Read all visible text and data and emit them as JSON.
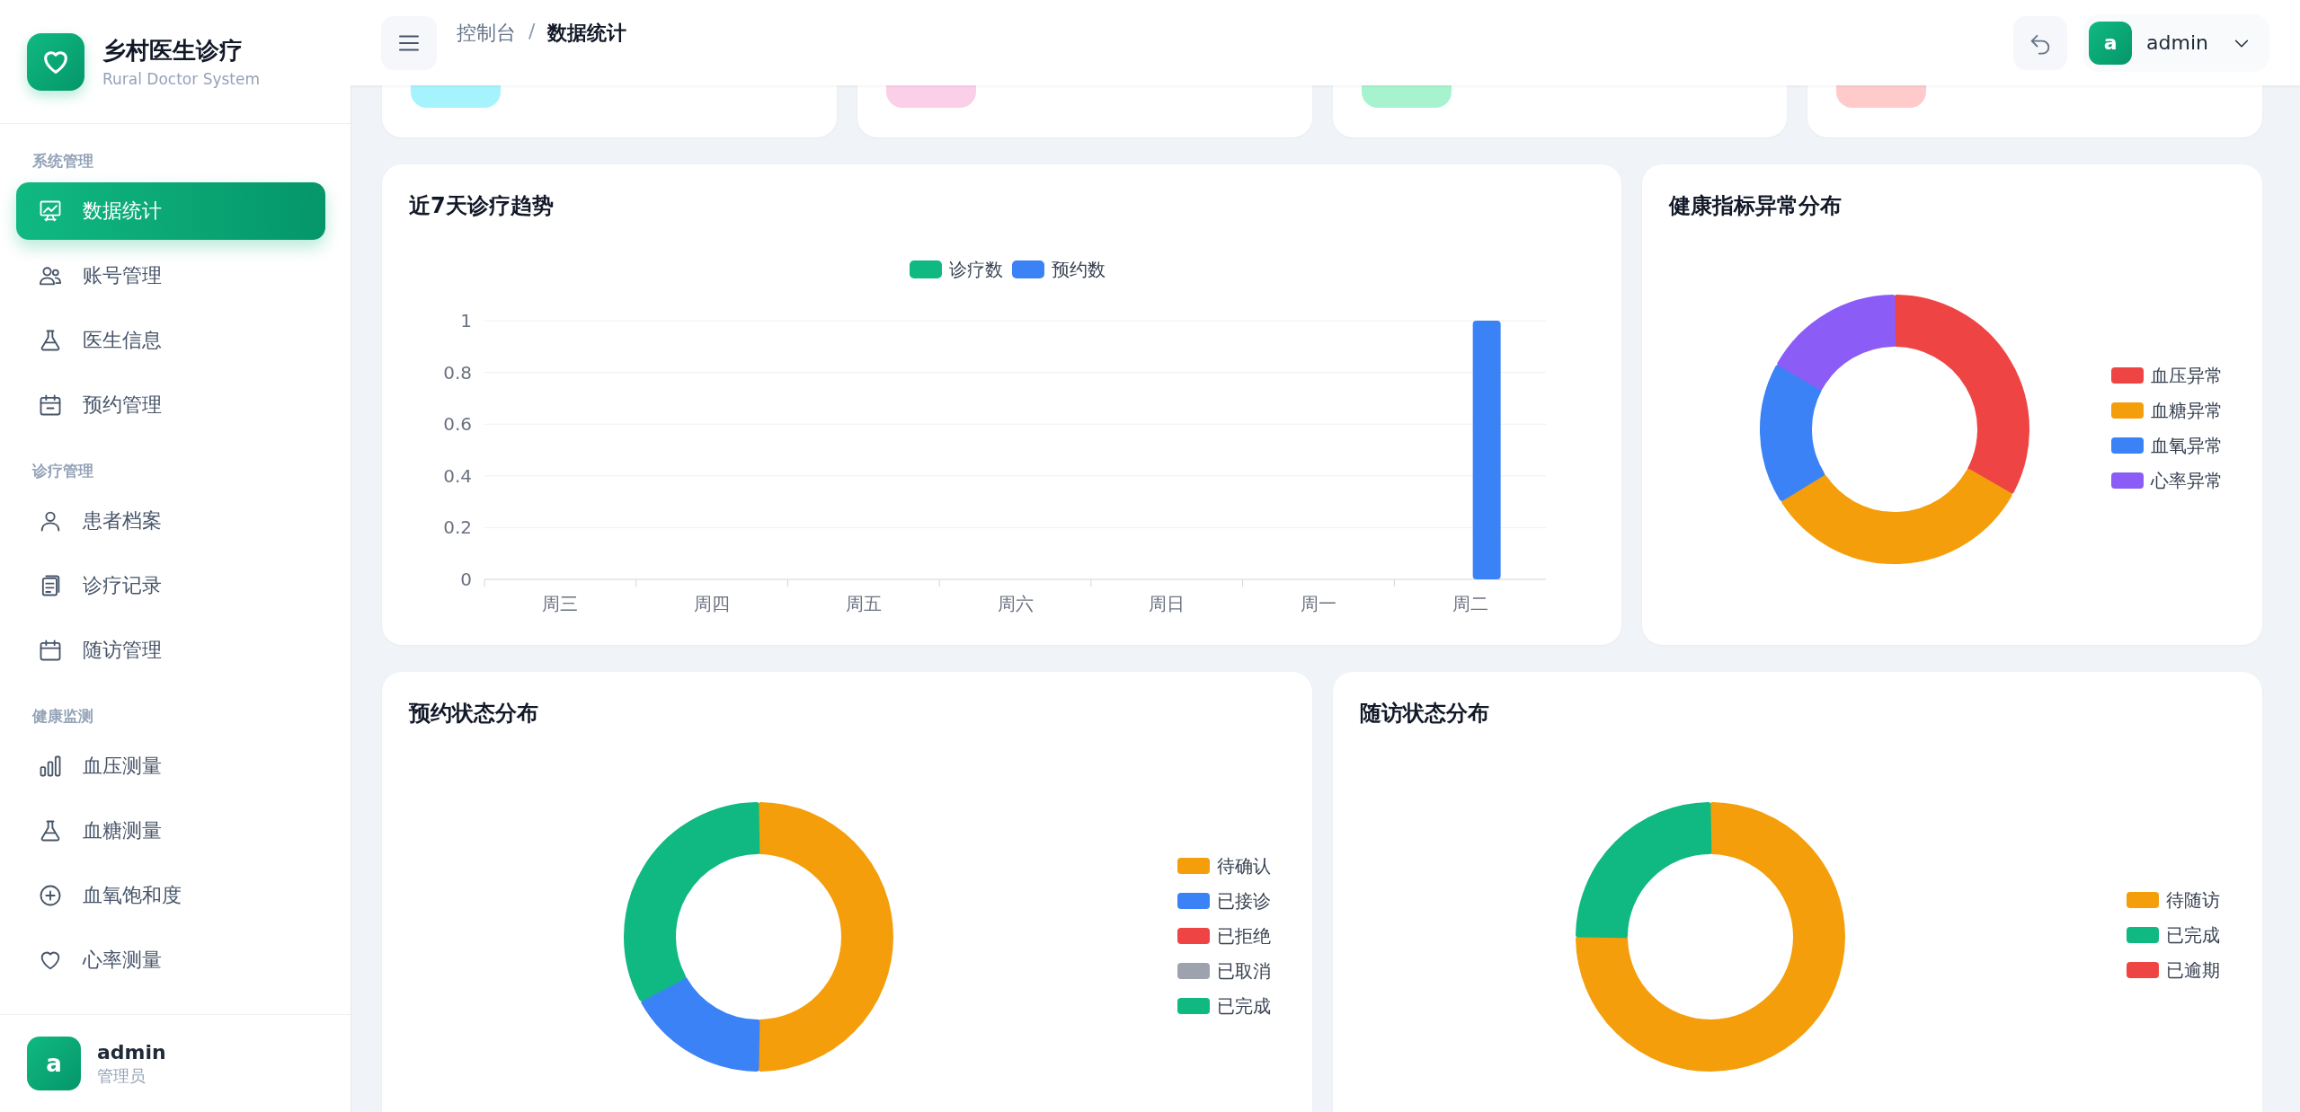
{
  "brand": {
    "title": "乡村医生诊疗",
    "subtitle": "Rural Doctor System"
  },
  "sidebar": {
    "groups": [
      {
        "label": "系统管理",
        "items": [
          {
            "label": "数据统计",
            "selected": true
          },
          {
            "label": "账号管理",
            "selected": false
          },
          {
            "label": "医生信息",
            "selected": false
          },
          {
            "label": "预约管理",
            "selected": false
          }
        ]
      },
      {
        "label": "诊疗管理",
        "items": [
          {
            "label": "患者档案",
            "selected": false
          },
          {
            "label": "诊疗记录",
            "selected": false
          },
          {
            "label": "随访管理",
            "selected": false
          }
        ]
      },
      {
        "label": "健康监测",
        "items": [
          {
            "label": "血压测量",
            "selected": false
          },
          {
            "label": "血糖测量",
            "selected": false
          },
          {
            "label": "血氧饱和度",
            "selected": false
          },
          {
            "label": "心率测量",
            "selected": false
          }
        ]
      }
    ],
    "user": {
      "avatar": "a",
      "name": "admin",
      "role": "管理员"
    }
  },
  "header": {
    "breadcrumb": [
      "控制台",
      "数据统计"
    ],
    "separator": "/",
    "user": {
      "avatar": "a",
      "name": "admin"
    }
  },
  "stats": [
    {
      "color": "#a5f3fc"
    },
    {
      "color": "#fbcfe8"
    },
    {
      "color": "#a7f3d0"
    },
    {
      "color": "#fecaca"
    }
  ],
  "trend": {
    "title": "近7天诊疗趋势",
    "chart_data": {
      "type": "bar",
      "grid": true,
      "categories": [
        "周三",
        "周四",
        "周五",
        "周六",
        "周日",
        "周一",
        "周二"
      ],
      "ylim": [
        0,
        1
      ],
      "yticks": [
        0,
        {
          "value": 0.2,
          "label": "0.2"
        },
        {
          "value": 0.4,
          "label": "0.4"
        },
        {
          "value": 0.6,
          "label": "0.6"
        },
        {
          "value": 0.8,
          "label": "0.8"
        },
        1
      ],
      "series": [
        {
          "name": "诊疗数",
          "color": "#10b981",
          "values": [
            0,
            0,
            0,
            0,
            0,
            0,
            0
          ]
        },
        {
          "name": "预约数",
          "color": "#3b82f6",
          "values": [
            0,
            0,
            0,
            0,
            0,
            0,
            1
          ]
        }
      ]
    }
  },
  "health": {
    "title": "健康指标异常分布",
    "chart_data": {
      "type": "donut",
      "categories": [
        "血压异常",
        "血糖异常",
        "血氧异常",
        "心率异常"
      ],
      "values": [
        33,
        33,
        17,
        17
      ],
      "legend": "right",
      "colors": [
        "#ef4444",
        "#f59e0b",
        "#3b82f6",
        "#8b5cf6"
      ]
    }
  },
  "appointments": {
    "title": "预约状态分布",
    "chart_data": {
      "type": "donut",
      "categories": [
        "待确认",
        "已接诊",
        "已拒绝",
        "已取消",
        "已完成"
      ],
      "values": [
        50,
        17,
        0,
        0,
        33
      ],
      "legend": "right",
      "colors": [
        "#f59e0b",
        "#3b82f6",
        "#ef4444",
        "#9ca3af",
        "#10b981"
      ]
    }
  },
  "followups": {
    "title": "随访状态分布",
    "chart_data": {
      "type": "donut",
      "categories": [
        "待随访",
        "已完成",
        "已逾期"
      ],
      "values": [
        75,
        25,
        0
      ],
      "legend": "right",
      "colors": [
        "#f59e0b",
        "#10b981",
        "#ef4444"
      ]
    }
  }
}
